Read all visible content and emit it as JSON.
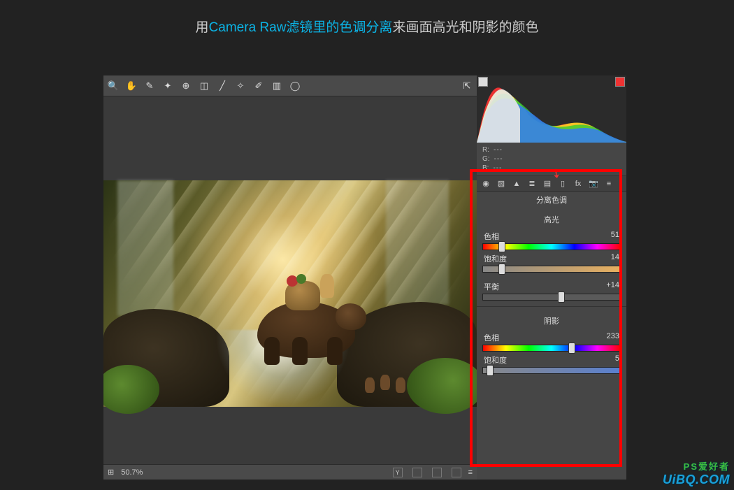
{
  "caption": {
    "prefix": "用",
    "accent": "Camera Raw滤镜里的色调分离",
    "suffix": "来画面高光和阴影的颜色"
  },
  "toolbar": {
    "icons": [
      "zoom",
      "hand",
      "eyedropper",
      "sampler",
      "crop-overlay",
      "crop",
      "ruler",
      "spot",
      "brush",
      "grad",
      "radial"
    ],
    "export_icon": "export"
  },
  "statusbar": {
    "grid_icon": "grid",
    "zoom": "50.7%",
    "right_icons": [
      "Y",
      "compare",
      "box",
      "box",
      "menu"
    ]
  },
  "rgb": {
    "r_label": "R:",
    "g_label": "G:",
    "b_label": "B:",
    "dash": "---"
  },
  "tabs": {
    "icons": [
      "basic",
      "curve",
      "detail",
      "hsl",
      "split",
      "lens",
      "fx",
      "camera",
      "presets"
    ]
  },
  "panel": {
    "title": "分离色调",
    "highlights_title": "高光",
    "shadows_title": "阴影",
    "hue_label": "色相",
    "sat_label": "饱和度",
    "balance_label": "平衡",
    "highlights": {
      "hue": "51",
      "sat": "14"
    },
    "balance": "+14",
    "shadows": {
      "hue": "233",
      "sat": "5"
    }
  },
  "watermark": {
    "line1": "PS爱好者",
    "line2": "UiBQ.COM"
  }
}
